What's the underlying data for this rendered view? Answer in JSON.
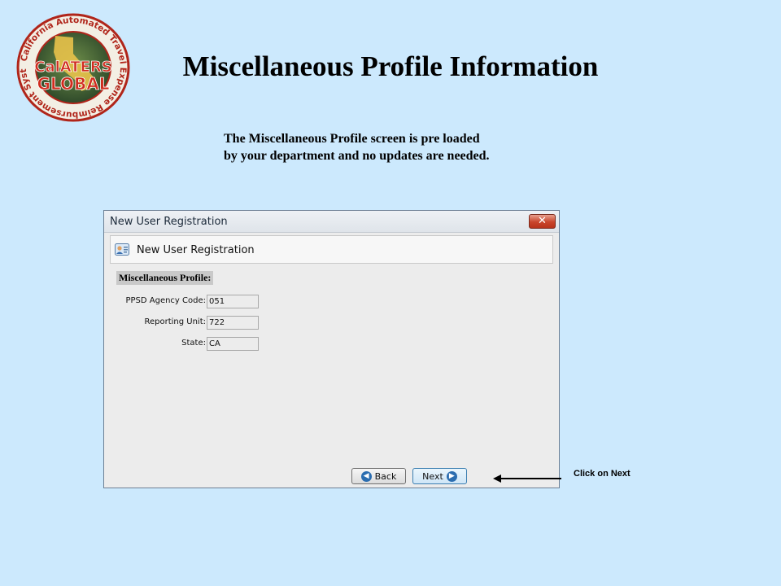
{
  "logo": {
    "ring_text": "California Automated Travel Expense Reimbursement System",
    "brand_line1": "CalATERS",
    "brand_line2": "GLOBAL"
  },
  "slide": {
    "title": "Miscellaneous Profile Information",
    "instruction_line1": "The Miscellaneous Profile screen is pre loaded",
    "instruction_line2": "by your department and no updates are needed."
  },
  "window": {
    "title": "New User Registration",
    "close_glyph": "✕",
    "header_title": "New User Registration",
    "section_label": "Miscellaneous Profile:",
    "fields": [
      {
        "label": "PPSD Agency Code:",
        "value": "051"
      },
      {
        "label": "Reporting Unit:",
        "value": "722"
      },
      {
        "label": "State:",
        "value": "CA"
      }
    ],
    "back_label": "Back",
    "next_label": "Next"
  },
  "annotation": {
    "text": "Click on Next"
  },
  "colors": {
    "background": "#cce9fd",
    "close_button": "#c9452b",
    "button_icon": "#2a6db0"
  },
  "icons": [
    "user-card-icon",
    "back-arrow-icon",
    "next-arrow-icon",
    "close-icon"
  ]
}
